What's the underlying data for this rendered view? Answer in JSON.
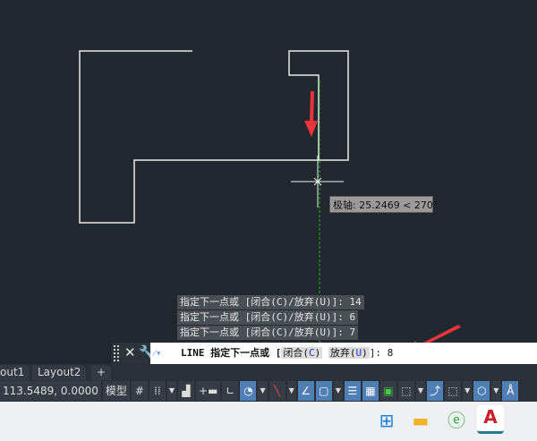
{
  "canvas": {
    "tooltip": "极轴: 25.2469 < 270°"
  },
  "history": [
    "指定下一点或 [闭合(C)/放弃(U)]: 14",
    "指定下一点或 [闭合(C)/放弃(U)]: 6",
    "指定下一点或 [闭合(C)/放弃(U)]: 7"
  ],
  "command": {
    "prefix": "LINE 指定下一点或 [",
    "opt1": "闭合(",
    "key1": "C",
    "opt1_end": ")",
    "opt2": "放弃(",
    "key2": "U",
    "opt2_end": ")",
    "suffix": "]: ",
    "value": "8"
  },
  "tabs": [
    "out1",
    "Layout2",
    "+"
  ],
  "status": {
    "coords": "113.5489, 0.0000",
    "model": "模型"
  },
  "colors": {
    "canvas": "#212830",
    "accent": "#4f7fb5",
    "arrow": "#e8343a",
    "tracking": "#1faa1f"
  }
}
